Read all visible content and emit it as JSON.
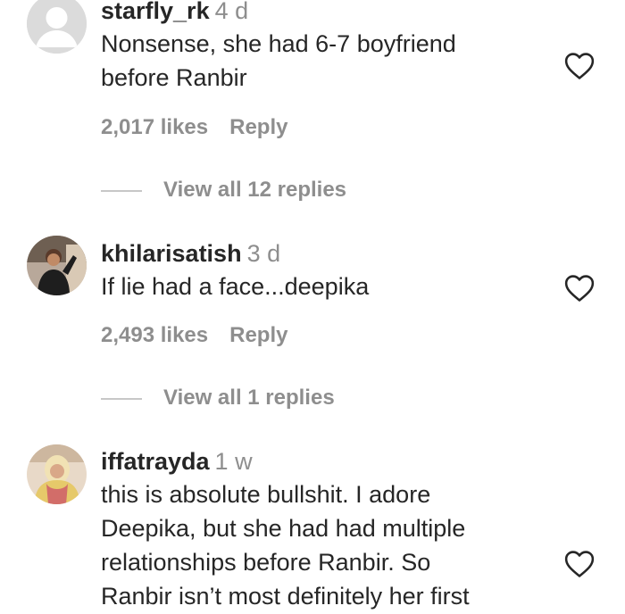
{
  "comments": [
    {
      "username": "starfly_rk",
      "time": "4 d",
      "text_lines": [
        "Nonsense, she had 6-7 boyfriend",
        "before Ranbir"
      ],
      "likes": "2,017 likes",
      "reply_label": "Reply",
      "view_replies": "View all 12 replies",
      "avatar": "default-avatar"
    },
    {
      "username": "khilarisatish",
      "time": "3 d",
      "text_lines": [
        "If lie had a face...deepika"
      ],
      "likes": "2,493 likes",
      "reply_label": "Reply",
      "view_replies": "View all 1 replies",
      "avatar": "user-photo"
    },
    {
      "username": "iffatrayda",
      "time": "1 w",
      "text_lines": [
        "this is absolute bullshit. I adore",
        "Deepika, but she had had multiple",
        "relationships before Ranbir. So",
        "Ranbir isn’t most definitely her first"
      ],
      "avatar": "user-photo"
    }
  ],
  "icons": {
    "like": "heart-outline-icon"
  },
  "colors": {
    "primary_text": "#262626",
    "secondary_text": "#8e8e8e",
    "divider": "#c7c7c7",
    "background": "#ffffff"
  }
}
